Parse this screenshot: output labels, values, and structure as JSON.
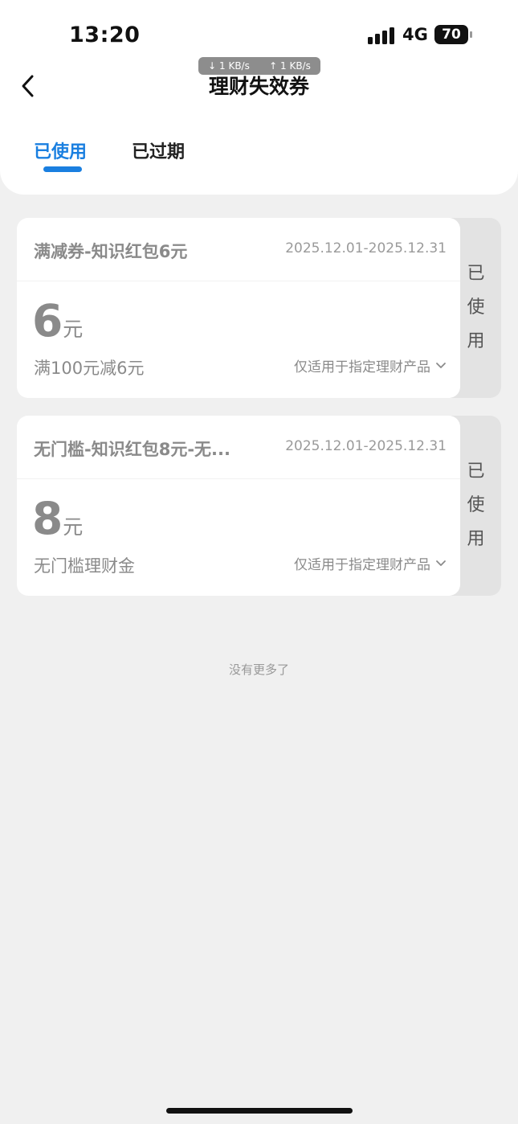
{
  "status_bar": {
    "time": "13:20",
    "network": "4G",
    "battery": "70",
    "download_speed": "↓ 1 KB/s",
    "upload_speed": "↑ 1 KB/s"
  },
  "header": {
    "title": "理财失效券",
    "back_icon": "chevron-left-icon"
  },
  "tabs": [
    {
      "label": "已使用",
      "active": true
    },
    {
      "label": "已过期",
      "active": false
    }
  ],
  "coupons": [
    {
      "name": "满减券-知识红包6元",
      "date_range": "2025.12.01-2025.12.31",
      "amount": "6",
      "unit": "元",
      "condition": "满100元减6元",
      "scope": "仅适用于指定理财产品",
      "status": [
        "已",
        "使",
        "用"
      ]
    },
    {
      "name": "无门槛-知识红包8元-无...",
      "date_range": "2025.12.01-2025.12.31",
      "amount": "8",
      "unit": "元",
      "condition": "无门槛理财金",
      "scope": "仅适用于指定理财产品",
      "status": [
        "已",
        "使",
        "用"
      ]
    }
  ],
  "footer_text": "没有更多了",
  "colors": {
    "accent": "#1a7fe0",
    "background": "#f0f0f0",
    "card": "#ffffff",
    "muted_text": "#8a8a8a"
  }
}
